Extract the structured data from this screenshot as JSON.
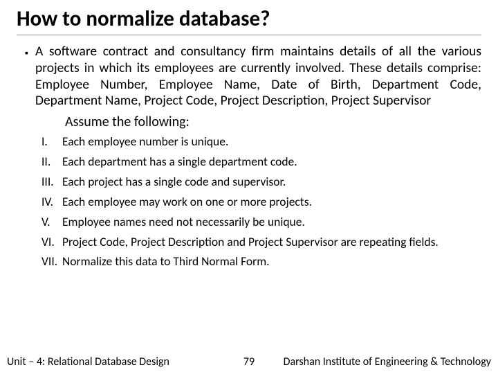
{
  "title": "How to normalize database?",
  "main_bullet": "A software contract and consultancy firm maintains details of all the various projects in which its employees are currently involved. These details comprise: Employee Number, Employee Name, Date of Birth, Department Code, Department Name, Project Code, Project Description, Project Supervisor",
  "assume": "Assume the following:",
  "items": [
    {
      "num": "I.",
      "text": "Each employee number is unique."
    },
    {
      "num": "II.",
      "text": "Each department has a single department code."
    },
    {
      "num": "III.",
      "text": "Each project has a single code and supervisor."
    },
    {
      "num": "IV.",
      "text": "Each employee may work on one or more projects."
    },
    {
      "num": "V.",
      "text": "Employee names need not necessarily be unique."
    },
    {
      "num": "VI.",
      "text": "Project Code, Project Description and Project Supervisor are repeating fields."
    },
    {
      "num": "VII.",
      "text": "Normalize this data to Third Normal Form."
    }
  ],
  "footer": {
    "left": "Unit – 4: Relational Database Design",
    "center": "79",
    "right": "Darshan Institute of Engineering & Technology"
  }
}
